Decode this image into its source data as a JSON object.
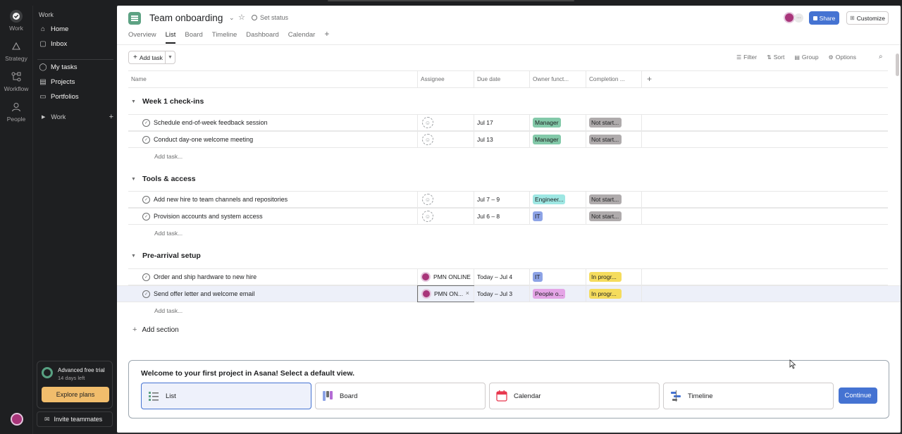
{
  "rail": {
    "items": [
      {
        "label": "Work",
        "icon": "check-circle-icon"
      },
      {
        "label": "Strategy",
        "icon": "triangle-icon"
      },
      {
        "label": "Workflow",
        "icon": "workflow-icon"
      },
      {
        "label": "People",
        "icon": "people-icon"
      }
    ]
  },
  "sidebar": {
    "heading": "Work",
    "items": [
      {
        "label": "Home",
        "icon": "home-icon"
      },
      {
        "label": "Inbox",
        "icon": "inbox-icon"
      },
      {
        "label": "My tasks",
        "icon": "check-circle-icon"
      },
      {
        "label": "Projects",
        "icon": "clipboard-icon"
      },
      {
        "label": "Portfolios",
        "icon": "folder-icon"
      }
    ],
    "work_group": "Work",
    "trial": {
      "title": "Advanced free trial",
      "days_left": "14 days left",
      "cta": "Explore plans"
    },
    "invite": "Invite teammates"
  },
  "header": {
    "title": "Team onboarding",
    "set_status": "Set status",
    "tabs": [
      "Overview",
      "List",
      "Board",
      "Timeline",
      "Dashboard",
      "Calendar"
    ],
    "active_tab": "List",
    "share": "Share",
    "customize": "Customize"
  },
  "toolbar": {
    "add_task": "Add task",
    "filter": "Filter",
    "sort": "Sort",
    "group": "Group",
    "options": "Options"
  },
  "table": {
    "columns": [
      "Name",
      "Assignee",
      "Due date",
      "Owner funct...",
      "Completion ..."
    ],
    "add_task_label": "Add task...",
    "add_section": "Add section",
    "sections": [
      {
        "title": "Week 1 check-ins",
        "rows": [
          {
            "name": "Schedule end-of-week feedback session",
            "assignee": "",
            "due": "Jul 17",
            "owner": "Manager",
            "owner_class": "mgr",
            "completion": "Not start...",
            "completion_class": "ns"
          },
          {
            "name": "Conduct day-one welcome meeting",
            "assignee": "",
            "due": "Jul 13",
            "owner": "Manager",
            "owner_class": "mgr",
            "completion": "Not start...",
            "completion_class": "ns"
          }
        ]
      },
      {
        "title": "Tools & access",
        "rows": [
          {
            "name": "Add new hire to team channels and repositories",
            "assignee": "",
            "due": "Jul 7 – 9",
            "owner": "Engineer...",
            "owner_class": "eng",
            "completion": "Not start...",
            "completion_class": "ns"
          },
          {
            "name": "Provision accounts and system access",
            "assignee": "",
            "due": "Jul 6 – 8",
            "owner": "IT",
            "owner_class": "it",
            "completion": "Not start...",
            "completion_class": "ns"
          }
        ]
      },
      {
        "title": "Pre-arrival setup",
        "rows": [
          {
            "name": "Order and ship hardware to new hire",
            "assignee": "PMN ONLINE",
            "due": "Today – Jul 4",
            "owner": "IT",
            "owner_class": "it",
            "completion": "In progr...",
            "completion_class": "ip"
          },
          {
            "name": "Send offer letter and welcome email",
            "assignee": "PMN ON...",
            "due": "Today – Jul 3",
            "owner": "People o...",
            "owner_class": "ppl",
            "completion": "In progr...",
            "completion_class": "ip"
          }
        ]
      }
    ]
  },
  "welcome": {
    "title": "Welcome to your first project in Asana! Select a default view.",
    "options": [
      "List",
      "Board",
      "Calendar",
      "Timeline"
    ],
    "continue": "Continue"
  },
  "colors": {
    "accent": "#4573d2",
    "project_icon": "#5da283",
    "trial_cta": "#f1bd6c"
  }
}
